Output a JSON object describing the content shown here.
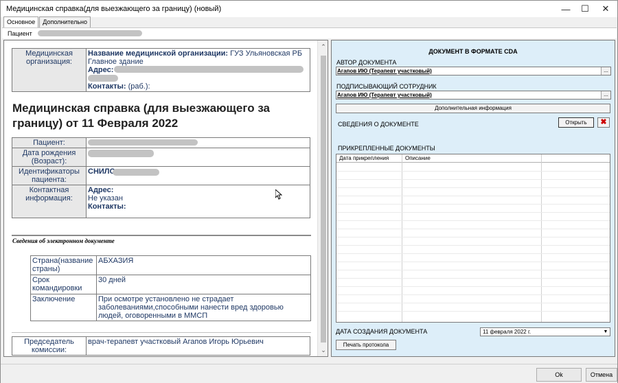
{
  "window": {
    "title": "Медицинская справка(для выезжающего за границу) (новый)"
  },
  "tabs": [
    "Основное",
    "Дополнительно"
  ],
  "patient_bar": {
    "label": "Пациент"
  },
  "left": {
    "org": {
      "label": "Медицинская организация:",
      "name_label": "Название медицинской организации:",
      "name_value": "ГУЗ Ульяновская РБ",
      "building": "Главное здание",
      "address_label": "Адрес:",
      "contacts_label": "Контакты:",
      "contacts_value": "(раб.):"
    },
    "heading": "Медицинская справка (для выезжающего за границу) от 11 Февраля 2022",
    "patient": {
      "rows": [
        {
          "label": "Пациент:"
        },
        {
          "label": "Дата рождения (Возраст):"
        },
        {
          "label": "Идентификаторы пациента:",
          "value_label": "СНИЛС"
        },
        {
          "label": "Контактная информация:",
          "address_label": "Адрес:",
          "address_value": "Не указан",
          "contacts_label": "Контакты:"
        }
      ]
    },
    "section_title": "Сведения об электронном документе",
    "details": [
      {
        "label": "Страна(название страны)",
        "value": "АБХАЗИЯ"
      },
      {
        "label": "Срок командировки",
        "value": "30 дней"
      },
      {
        "label": "Заключение",
        "value": "При осмотре установлено не страдает заболеваниями,способными нанести вред здоровью людей, оговоренными в ММСП"
      }
    ],
    "chairman": {
      "label": "Председатель комиссии:",
      "value": "врач-терапевт участковый Агапов Игорь Юрьевич"
    }
  },
  "right": {
    "title": "ДОКУМЕНТ В ФОРМАТЕ CDA",
    "author_label": "АВТОР ДОКУМЕНТА",
    "author_value": "Агапов ИЮ (Терапевт участковый)",
    "signer_label": "ПОДПИСЫВАЮЩИЙ СОТРУДНИК",
    "signer_value": "Агапов ИЮ (Терапевт участковый)",
    "more_info_button": "Дополнительная информация",
    "doc_info_label": "СВЕДЕНИЯ О ДОКУМЕНТЕ",
    "open_button": "Открыть",
    "attached_label": "ПРИКРЕПЛЕННЫЕ ДОКУМЕНТЫ",
    "grid_headers": [
      "Дата прикрепления",
      "Описание"
    ],
    "created_label": "ДАТА СОЗДАНИЯ ДОКУМЕНТА",
    "created_value": "11 февраля  2022 г.",
    "print_button": "Печать протокола"
  },
  "footer": {
    "ok": "Ok",
    "cancel": "Отмена"
  },
  "colors": {
    "left_text": "#1f3864",
    "right_panel_bg": "#ddeef9",
    "delete_icon": "#cc0000"
  }
}
